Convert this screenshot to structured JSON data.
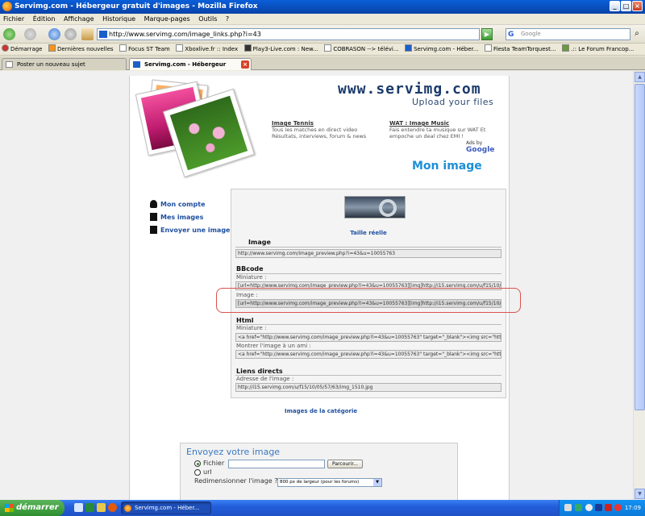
{
  "window": {
    "title": "Servimg.com - Hébergeur gratuit d'images - Mozilla Firefox",
    "controls": [
      "_",
      "□",
      "×"
    ]
  },
  "menu": [
    "Fichier",
    "Édition",
    "Affichage",
    "Historique",
    "Marque-pages",
    "Outils",
    "?"
  ],
  "nav": {
    "url": "http://www.servimg.com/image_links.php?i=43",
    "search_placeholder": "Google",
    "go_label": "▶"
  },
  "bookmarks": [
    "Démarrage",
    "Dernières nouvelles",
    "Focus ST Team",
    "Xboxlive.fr :: Index",
    "Play3-Live.com : New...",
    "COBRASON --> télévi...",
    "Servimg.com - Héber...",
    "Fiesta TeamTorquest...",
    ".:: Le Forum Francop..."
  ],
  "tabs": [
    {
      "label": "Poster un nouveau sujet"
    },
    {
      "label": "Servimg.com - Hébergeur gratuit..."
    }
  ],
  "site": {
    "logo": "www.servimg.com",
    "tagline": "Upload your files",
    "ads": [
      {
        "title": "Image Tennis",
        "text": "Tous les matches en direct video Résultats, interviews, forum & news"
      },
      {
        "title": "WAT : Image Music",
        "text": "Fais entendre ta musique sur WAT Et empoche un deal chez EMI !"
      }
    ],
    "ads_by": "Ads by",
    "ads_brand": "Google",
    "page_title": "Mon image"
  },
  "left_menu": [
    "Mon compte",
    "Mes images",
    "Envoyer une image"
  ],
  "links": {
    "real_size": "Taille réelle",
    "image_heading": "Image",
    "image_url": "http://www.servimg.com/image_preview.php?i=43&u=10055763",
    "bbcode_heading": "BBcode",
    "bb_thumb_label": "Miniature :",
    "bb_thumb_value": "[url=http://www.servimg.com/image_preview.php?i=43&u=10055763][img]http://i15.servimg.com/u/f15/10/05/",
    "bb_image_label": "Image :",
    "bb_image_value": "[url=http://www.servimg.com/image_preview.php?i=43&u=10055763][img]http://i15.servimg.com/u/f15/10/05/",
    "html_heading": "Html",
    "html_thumb_label": "Miniature :",
    "html_thumb_value": "<a href=\"http://www.servimg.com/image_preview.php?i=43&u=10055763\" target=\"_blank\"><img src=\"http://",
    "html_friend_label": "Montrer l'image à un ami :",
    "html_friend_value": "<a href=\"http://www.servimg.com/image_preview.php?i=43&u=10055763\" target=\"_blank\"><img src=\"http://",
    "direct_heading": "Liens directs",
    "direct_label": "Adresse de l'image :",
    "direct_value": "http://i15.servimg.com/u/f15/10/05/57/63/img_1510.jpg",
    "category_link": "Images de la catégorie"
  },
  "upload": {
    "title": "Envoyez votre image",
    "opt_file": "Fichier",
    "opt_url": "url",
    "browse": "Parcourir...",
    "resize_label": "Redimensionner l'image ?",
    "resize_value": "800 px de largeur (pour les forums)"
  },
  "taskbar": {
    "start": "démarrer",
    "task": "Servimg.com - Héber...",
    "clock": "17:09"
  }
}
